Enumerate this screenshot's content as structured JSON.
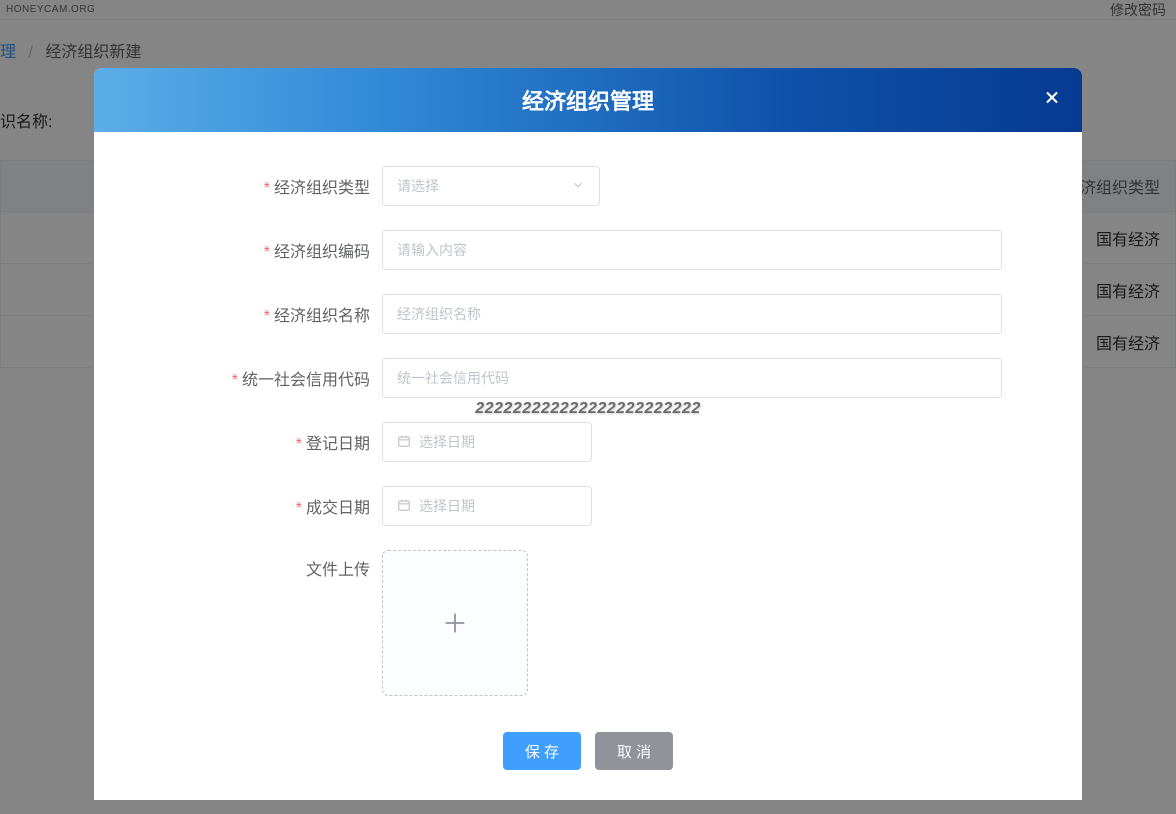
{
  "watermark": "HONEYCAM.ORG",
  "background": {
    "header_link": "修改密码",
    "breadcrumb": {
      "prev": "理",
      "sep": "/",
      "current": "经济组织新建"
    },
    "filter_label": "识名称:",
    "table_header_col": "济组织类型",
    "rows": [
      "国有经济",
      "国有经济",
      "国有经济"
    ]
  },
  "ghost_text": "222222222222222222222222",
  "modal": {
    "title": "经济组织管理",
    "fields": {
      "org_type": {
        "label": "经济组织类型",
        "placeholder": "请选择"
      },
      "org_code": {
        "label": "经济组织编码",
        "placeholder": "请输入内容"
      },
      "org_name": {
        "label": "经济组织名称",
        "placeholder": "经济组织名称"
      },
      "social_code": {
        "label": "统一社会信用代码",
        "placeholder": "统一社会信用代码"
      },
      "reg_date": {
        "label": "登记日期",
        "placeholder": "选择日期"
      },
      "deal_date": {
        "label": "成交日期",
        "placeholder": "选择日期"
      },
      "file_upload": {
        "label": "文件上传"
      }
    },
    "buttons": {
      "save": "保 存",
      "cancel": "取 消"
    }
  }
}
